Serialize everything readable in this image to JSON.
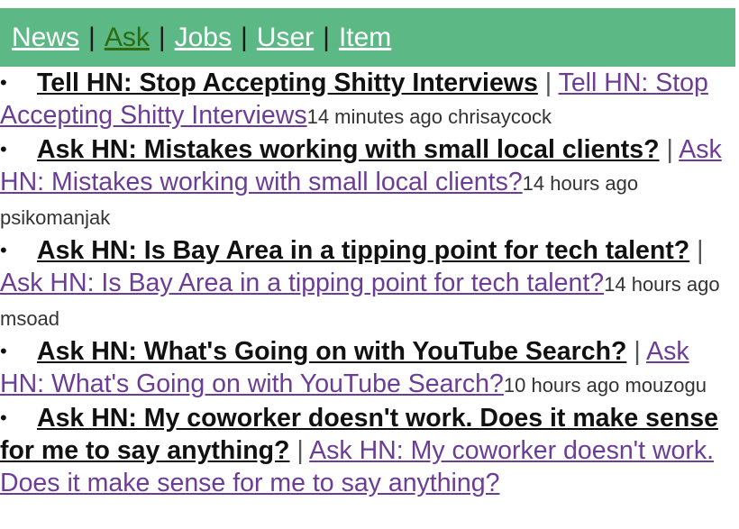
{
  "nav": {
    "items": [
      {
        "label": "News",
        "active": false
      },
      {
        "label": "Ask",
        "active": true
      },
      {
        "label": "Jobs",
        "active": false
      },
      {
        "label": "User",
        "active": false
      },
      {
        "label": "Item",
        "active": false
      }
    ],
    "separator": "|"
  },
  "colors": {
    "nav_background": "#5cb885",
    "nav_link": "#ffffff",
    "nav_active_link": "#2d6b0f",
    "visited_link": "#6c3d96"
  },
  "stories": [
    {
      "title": "Tell HN: Stop Accepting Shitty Interviews",
      "link_text": "Tell HN: Stop Accepting Shitty Interviews",
      "time": "14 minutes ago",
      "user": "chrisaycock"
    },
    {
      "title": "Ask HN: Mistakes working with small local clients?",
      "link_text": "Ask HN: Mistakes working with small local clients?",
      "time": "14 hours ago",
      "user": "psikomanjak"
    },
    {
      "title": "Ask HN: Is Bay Area in a tipping point for tech talent?",
      "link_text": "Ask HN: Is Bay Area in a tipping point for tech talent?",
      "time": "14 hours ago",
      "user": "msoad"
    },
    {
      "title": "Ask HN: What's Going on with YouTube Search?",
      "link_text": "Ask HN: What's Going on with YouTube Search?",
      "time": "10 hours ago",
      "user": "mouzogu"
    },
    {
      "title": "Ask HN: My coworker doesn't work. Does it make sense for me to say anything?",
      "link_text": "Ask HN: My coworker doesn't work. Does it make sense for me to say anything?",
      "time": "",
      "user": ""
    }
  ]
}
